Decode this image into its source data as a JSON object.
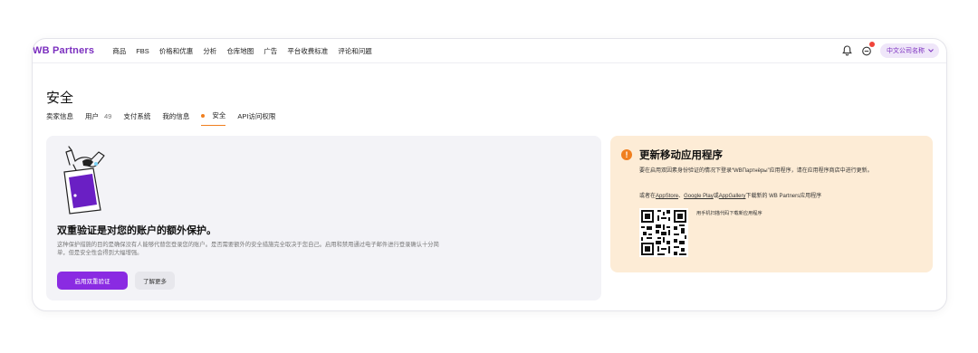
{
  "header": {
    "logo": "WB Partners",
    "nav": [
      "商品",
      "FBS",
      "价格和优惠",
      "分析",
      "仓库地图",
      "广告",
      "平台收费标准",
      "评论和问题"
    ],
    "account_label": "中文公司名称"
  },
  "page": {
    "title": "安全",
    "tabs": [
      {
        "label": "卖家信息"
      },
      {
        "label": "用户",
        "count": "49"
      },
      {
        "label": "支付系统"
      },
      {
        "label": "我的信息"
      },
      {
        "label": "安全",
        "active": true
      },
      {
        "label": "API访问权限"
      }
    ]
  },
  "two_factor": {
    "title": "双重验证是对您的账户的额外保护。",
    "description": "这种保护措施的目的是确保没有人能够代替您登录您的账户。是否需要额外的安全措施完全取决于您自己。启用和禁用通过电子邮件进行登录确认十分简单，但是安全性会得到大幅增强。",
    "enable_button": "启用双重验证",
    "learn_more_button": "了解更多"
  },
  "app_update": {
    "title": "更新移动应用程序",
    "desc1": "要在启用双因素身份验证的情况下登录“WBПартнёры”应用程序，请在应用程序商店中进行更新。",
    "desc2_prefix": "或者在",
    "appstore": "AppStore",
    "sep1": "、",
    "googleplay": "Google Play",
    "sep2": "或",
    "appgallery": "AppGallery",
    "desc2_suffix": "下载新的 WB Partners应用程序",
    "qr_caption": "用手机扫描代码下载新应用程序"
  },
  "colors": {
    "brand": "#7b2fbf",
    "primary_button": "#8a2be2",
    "tab_accent": "#f07f1f",
    "notice_bg": "#fdecd6"
  }
}
